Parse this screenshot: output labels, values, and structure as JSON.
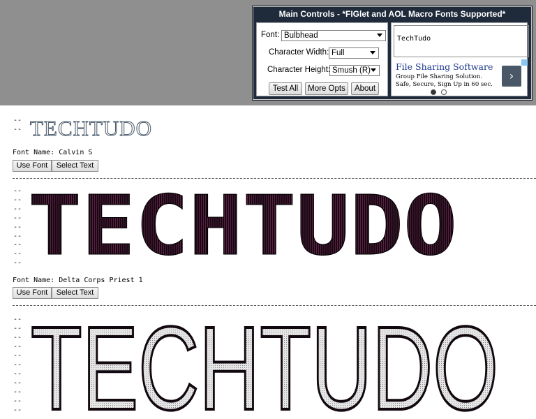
{
  "controls": {
    "title": "Main Controls - *FIGlet and AOL Macro Fonts Supported*",
    "font_label": "Font:",
    "font_value": "Bulbhead",
    "width_label": "Character Width:",
    "width_value": "Full",
    "height_label": "Character Height:",
    "height_value": "Smush (R)",
    "test_all": "Test All",
    "more_opts": "More Opts",
    "about": "About",
    "input_text": "TechTudo"
  },
  "ad": {
    "title": "File Sharing Software",
    "line1": "Group File Sharing Solution.",
    "line2": "Safe, Secure, Sign Up in 60 sec.",
    "next_glyph": "›"
  },
  "results": [
    {
      "dashes": "--\n--",
      "art_text": "TECHTUDO",
      "font_name": "Font Name: Calvin S",
      "use_font": "Use Font",
      "select_text": "Select Text"
    },
    {
      "dashes": "--\n--\n--\n--\n--\n--\n--\n--\n--",
      "art_text": "TECHTUDO",
      "font_name": "Font Name: Delta Corps Priest 1",
      "use_font": "Use Font",
      "select_text": "Select Text"
    },
    {
      "dashes": "--\n--\n--\n--\n--\n--\n--\n--\n--\n--\n--",
      "art_text": "TECHTUDO"
    }
  ],
  "colors": {
    "band": "#8f8f8f",
    "panel": "#1f2b3b",
    "ad_title": "#1f3a8c",
    "art_fill": "#1a0a14"
  }
}
